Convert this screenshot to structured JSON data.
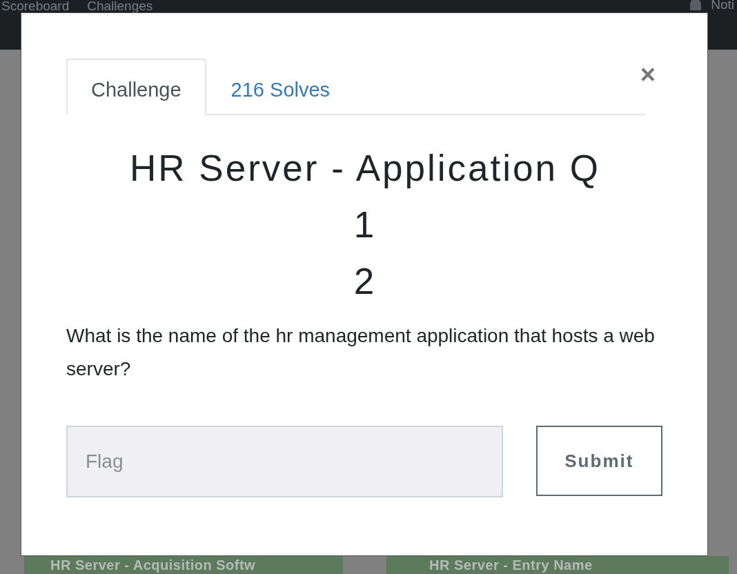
{
  "navbar": {
    "items": [
      {
        "label": "Scoreboard"
      },
      {
        "label": "Challenges"
      }
    ],
    "notifications": {
      "label": "Noti"
    }
  },
  "background_cards": [
    {
      "title": "HR Server - Acquisition Softw"
    },
    {
      "title": "HR Server - Entry Name"
    }
  ],
  "modal": {
    "tabs": [
      {
        "label": "Challenge",
        "selected": true
      },
      {
        "label": "216 Solves",
        "selected": false
      }
    ],
    "close": "×",
    "title_lines": [
      "HR Server - Application Q",
      "1",
      "2"
    ],
    "description": "What is the name of the hr management application that hosts a web server?",
    "flag_field": {
      "placeholder": "Flag"
    },
    "submit": "Submit"
  }
}
